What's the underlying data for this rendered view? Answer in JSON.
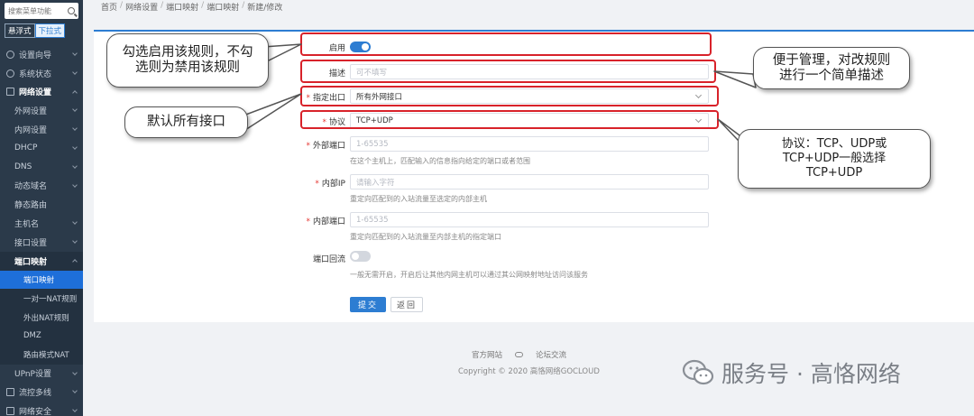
{
  "sidebar": {
    "search_placeholder": "搜索菜单功能",
    "modes": [
      "悬浮式",
      "下拉式"
    ],
    "items": [
      {
        "label": "设置向导",
        "type": "top"
      },
      {
        "label": "系统状态",
        "type": "top"
      },
      {
        "label": "网络设置",
        "type": "group"
      },
      {
        "label": "外网设置",
        "type": "sub"
      },
      {
        "label": "内网设置",
        "type": "sub"
      },
      {
        "label": "DHCP",
        "type": "sub"
      },
      {
        "label": "DNS",
        "type": "sub"
      },
      {
        "label": "动态域名",
        "type": "sub"
      },
      {
        "label": "静态路由",
        "type": "sub"
      },
      {
        "label": "主机名",
        "type": "sub"
      },
      {
        "label": "接口设置",
        "type": "sub"
      },
      {
        "label": "端口映射",
        "type": "sub-open"
      },
      {
        "label": "端口映射",
        "type": "sub2-selected"
      },
      {
        "label": "一对一NAT规则",
        "type": "sub2"
      },
      {
        "label": "外出NAT规则",
        "type": "sub2"
      },
      {
        "label": "DMZ",
        "type": "sub2"
      },
      {
        "label": "路由模式NAT",
        "type": "sub2"
      },
      {
        "label": "UPnP设置",
        "type": "sub"
      },
      {
        "label": "流控多线",
        "type": "top"
      },
      {
        "label": "网络安全",
        "type": "top"
      }
    ]
  },
  "breadcrumb": [
    "首页",
    "网络设置",
    "端口映射",
    "端口映射",
    "新建/修改"
  ],
  "form": {
    "enable_label": "启用",
    "enabled": true,
    "desc_label": "描述",
    "desc_placeholder": "可不填写",
    "iface_label": "指定出口",
    "iface_value": "所有外网接口",
    "proto_label": "协议",
    "proto_value": "TCP+UDP",
    "ext_port_label": "外部端口",
    "ext_port_placeholder": "1-65535",
    "ext_port_hint": "在这个主机上，匹配输入的信息指向给定的端口或者范围",
    "int_ip_label": "内部IP",
    "int_ip_placeholder": "请输入字符",
    "int_ip_hint": "重定向匹配到的入站流量至选定的内部主机",
    "int_port_label": "内部端口",
    "int_port_placeholder": "1-65535",
    "int_port_hint": "重定向匹配到的入站流量至内部主机的指定端口",
    "loopback_label": "端口回流",
    "loopback_enabled": false,
    "loopback_hint": "一般无需开启，开启后让其他内网主机可以通过其公网映射地址访问该服务",
    "submit_label": "提交",
    "back_label": "返回"
  },
  "callouts": {
    "enable": "勾选启用该规则，不勾选则为禁用该规则",
    "desc": "便于管理，对改规则进行一个简单描述",
    "iface": "默认所有接口",
    "proto": "协议：TCP、UDP或TCP+UDP一般选择TCP+UDP"
  },
  "footer": {
    "link1": "官方网站",
    "link2": "论坛交流",
    "copyright": "Copyright © 2020 高恪网络GOCLOUD"
  },
  "watermark": "服务号 · 高恪网络"
}
